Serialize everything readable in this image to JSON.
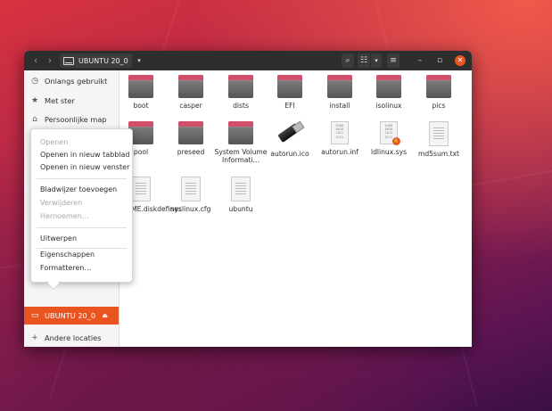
{
  "pathbar": {
    "label": "UBUNTU 20_0",
    "dropdown_icon": "▾"
  },
  "toolbar": {
    "search_icon": "⌕",
    "view_list_icon": "☷",
    "view_dropdown_icon": "▾",
    "menu_icon": "≡",
    "min_icon": "–",
    "max_icon": "▫",
    "close_icon": "✕",
    "back_icon": "‹",
    "forward_icon": "›"
  },
  "sidebar": {
    "items": [
      {
        "label": "Onlangs gebruikt",
        "icon": "◷"
      },
      {
        "label": "Met ster",
        "icon": "★"
      },
      {
        "label": "Persoonlijke map",
        "icon": "⌂"
      },
      {
        "label": "UBUNTU 20_0",
        "icon": "▭",
        "eject": "⏏"
      },
      {
        "label": "Andere locaties",
        "icon": "+"
      }
    ]
  },
  "files": [
    {
      "name": "boot",
      "type": "folder"
    },
    {
      "name": "casper",
      "type": "folder"
    },
    {
      "name": "dists",
      "type": "folder"
    },
    {
      "name": "EFI",
      "type": "folder"
    },
    {
      "name": "install",
      "type": "folder"
    },
    {
      "name": "isolinux",
      "type": "folder"
    },
    {
      "name": "pics",
      "type": "folder"
    },
    {
      "name": "pool",
      "type": "folder"
    },
    {
      "name": "preseed",
      "type": "folder"
    },
    {
      "name": "System Volume Informati…",
      "type": "folder"
    },
    {
      "name": "autorun.ico",
      "type": "image"
    },
    {
      "name": "autorun.inf",
      "type": "binary"
    },
    {
      "name": "ldlinux.sys",
      "type": "binary-locked"
    },
    {
      "name": "md5sum.txt",
      "type": "text"
    },
    {
      "name": "README.diskdefines",
      "type": "text"
    },
    {
      "name": "syslinux.cfg",
      "type": "text"
    },
    {
      "name": "ubuntu",
      "type": "text"
    }
  ],
  "binary_text": "0100\n0010\n1011\n0111",
  "context_menu": {
    "items": [
      {
        "label": "Openen",
        "disabled": true
      },
      {
        "label": "Openen in nieuw tabblad",
        "disabled": false
      },
      {
        "label": "Openen in nieuw venster",
        "disabled": false
      },
      {
        "label": "Bladwijzer toevoegen",
        "disabled": false
      },
      {
        "label": "Verwijderen",
        "disabled": true
      },
      {
        "label": "Hernoemen…",
        "disabled": true
      },
      {
        "label": "Uitwerpen",
        "disabled": false
      },
      {
        "label": "Eigenschappen",
        "disabled": false
      },
      {
        "label": "Formatteren…",
        "disabled": false
      }
    ]
  },
  "colors": {
    "accent": "#e95420",
    "headerbar": "#2e2e2e"
  }
}
